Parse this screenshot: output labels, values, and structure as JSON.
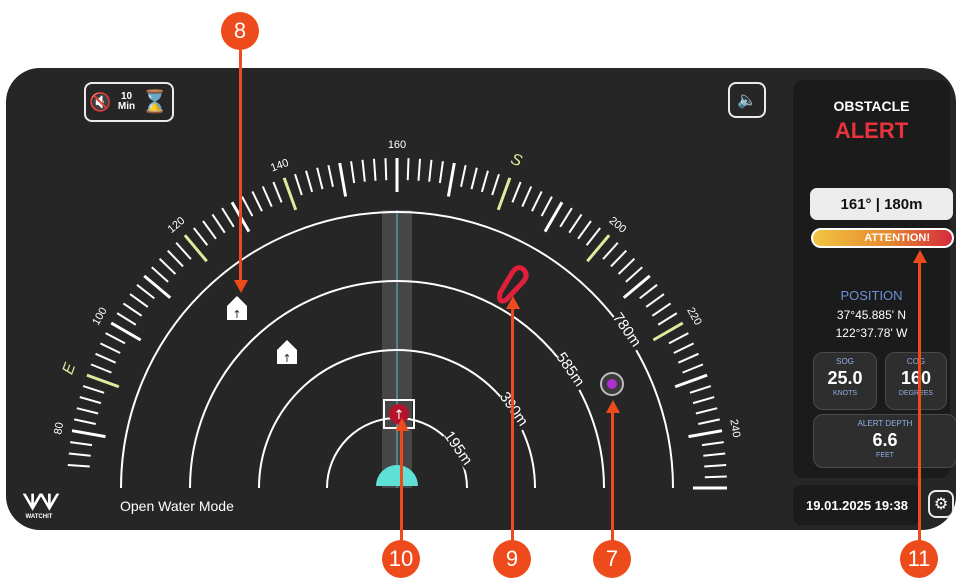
{
  "header": {
    "timer_value": "10",
    "timer_unit": "Min"
  },
  "radar": {
    "compass_labels": [
      "80",
      "100",
      "120",
      "140",
      "160",
      "200",
      "220",
      "240"
    ],
    "cardinals": [
      "E",
      "S"
    ],
    "range_labels": [
      "195m",
      "390m",
      "585m",
      "780m"
    ],
    "accent_color": "#ddeb9c"
  },
  "panel": {
    "alert_line1": "OBSTACLE",
    "alert_line2": "ALERT",
    "bearing_distance": "161° | 180m",
    "attention_label": "ATTENTION!",
    "position_label": "POSITION",
    "latitude": "37°45.885' N",
    "longitude": "122°37.78' W",
    "sog": {
      "label": "SOG",
      "value": "25.0",
      "unit": "KNOTS"
    },
    "cog": {
      "label": "COG",
      "value": "160",
      "unit": "DEGREES"
    },
    "depth": {
      "label": "ALERT DEPTH",
      "value": "6.6",
      "unit": "FEET"
    },
    "alert_color": "#e8323c"
  },
  "footer": {
    "logo_text": "WATCHIT",
    "mode": "Open Water Mode",
    "datetime": "19.01.2025 19:38"
  },
  "callouts": [
    "8",
    "10",
    "9",
    "7",
    "11"
  ]
}
